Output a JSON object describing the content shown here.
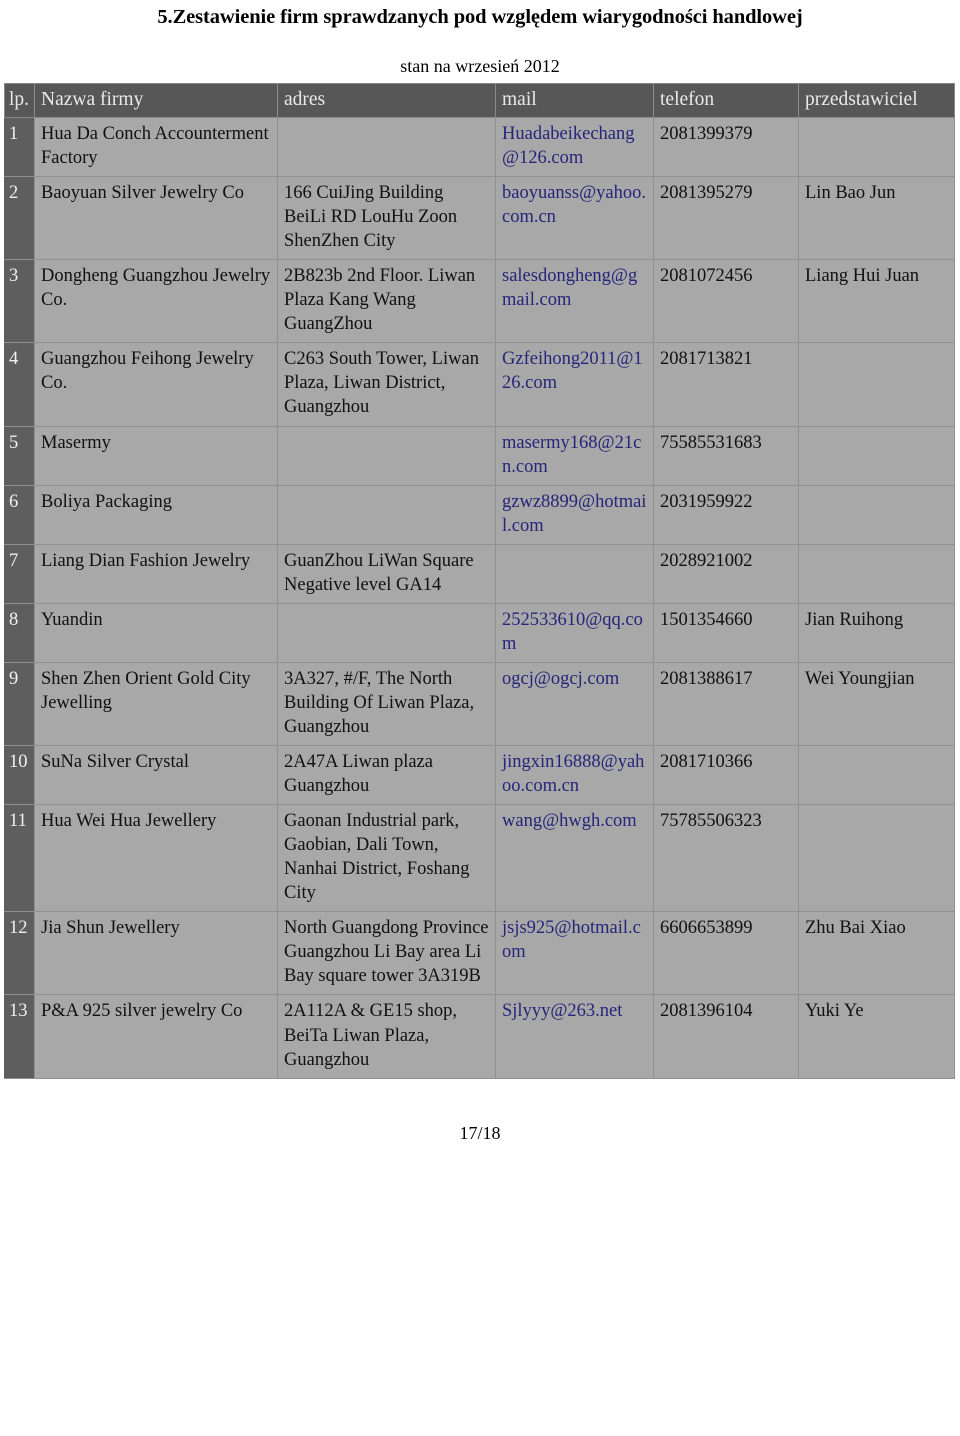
{
  "document": {
    "title": "5.Zestawienie firm sprawdzanych pod względem wiarygodności handlowej",
    "subtitle": "stan na wrzesień 2012",
    "footer": "17/18"
  },
  "colors": {
    "header_bg": "#575757",
    "header_text": "#e9e9e9",
    "row_bg": "#a8a8a8",
    "lp_bg": "#5e5e5e",
    "mail_text": "#26257a",
    "page_bg": "#ffffff"
  },
  "table": {
    "columns": [
      {
        "key": "lp",
        "label": "lp."
      },
      {
        "key": "name",
        "label": "Nazwa firmy"
      },
      {
        "key": "adres",
        "label": "adres"
      },
      {
        "key": "mail",
        "label": "mail"
      },
      {
        "key": "tel",
        "label": "telefon"
      },
      {
        "key": "rep",
        "label": "przedstawiciel"
      }
    ],
    "rows": [
      {
        "lp": "1",
        "name": "Hua Da Conch Accounterment Factory",
        "adres": "",
        "mail": "Huadabeikechang@126.com",
        "tel": "2081399379",
        "rep": ""
      },
      {
        "lp": "2",
        "name": "Baoyuan Silver Jewelry Co",
        "adres": "166 CuiJing Building BeiLi RD LouHu Zoon ShenZhen City",
        "mail": "baoyuanss@yahoo.com.cn",
        "tel": "2081395279",
        "rep": "Lin Bao Jun"
      },
      {
        "lp": "3",
        "name": "Dongheng Guangzhou Jewelry Co.",
        "adres": "2B823b 2nd Floor. Liwan Plaza Kang Wang GuangZhou",
        "mail": "salesdongheng@gmail.com",
        "tel": "2081072456",
        "rep": "Liang Hui Juan"
      },
      {
        "lp": "4",
        "name": "Guangzhou Feihong Jewelry Co.",
        "adres": "C263 South Tower, Liwan Plaza, Liwan District, Guangzhou",
        "mail": "Gzfeihong2011@126.com",
        "tel": "2081713821",
        "rep": ""
      },
      {
        "lp": "5",
        "name": "Masermy",
        "adres": "",
        "mail": "masermy168@21cn.com",
        "tel": "75585531683",
        "rep": ""
      },
      {
        "lp": "6",
        "name": "Boliya Packaging",
        "adres": "",
        "mail": "gzwz8899@hotmail.com",
        "tel": "2031959922",
        "rep": ""
      },
      {
        "lp": "7",
        "name": "Liang Dian Fashion Jewelry",
        "adres": "GuanZhou LiWan Square Negative level GA14",
        "mail": "",
        "tel": "2028921002",
        "rep": ""
      },
      {
        "lp": "8",
        "name": "Yuandin",
        "adres": "",
        "mail": "252533610@qq.com",
        "tel": "1501354660",
        "rep": "Jian Ruihong"
      },
      {
        "lp": "9",
        "name": "Shen Zhen Orient Gold City Jewelling",
        "adres": "3A327, #/F, The North Building Of Liwan Plaza, Guangzhou",
        "mail": "ogcj@ogcj.com",
        "tel": "2081388617",
        "rep": "Wei Youngjian"
      },
      {
        "lp": "10",
        "name": "SuNa Silver Crystal",
        "adres": "2A47A Liwan plaza Guangzhou",
        "mail": "jingxin16888@yahoo.com.cn",
        "tel": "2081710366",
        "rep": ""
      },
      {
        "lp": "11",
        "name": "Hua Wei Hua Jewellery",
        "adres": "Gaonan Industrial park, Gaobian, Dali Town, Nanhai District, Foshang City",
        "mail": "wang@hwgh.com",
        "tel": "75785506323",
        "rep": ""
      },
      {
        "lp": "12",
        "name": "Jia Shun Jewellery",
        "adres": "North Guangdong Province Guangzhou Li Bay area Li Bay square tower 3A319B",
        "mail": "jsjs925@hotmail.com",
        "tel": "6606653899",
        "rep": "Zhu Bai Xiao"
      },
      {
        "lp": "13",
        "name": "P&A 925 silver jewelry Co",
        "adres": "2A112A & GE15 shop, BeiTa Liwan Plaza, Guangzhou",
        "mail": "Sjlyyy@263.net",
        "tel": "2081396104",
        "rep": "Yuki Ye"
      }
    ]
  }
}
